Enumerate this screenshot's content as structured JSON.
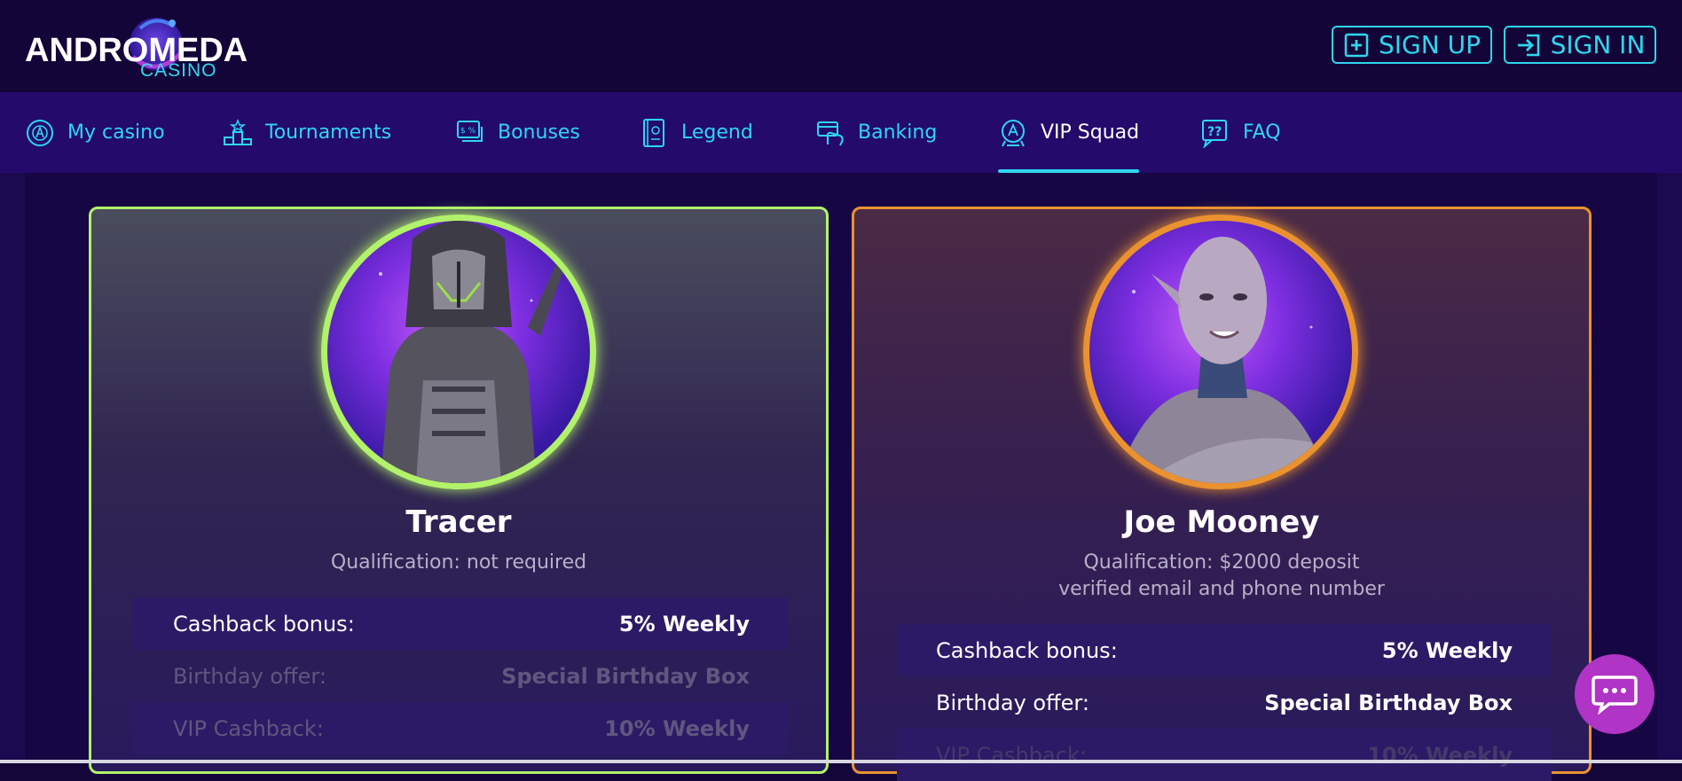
{
  "brand": {
    "name": "ANDROMEDA",
    "sub": "CASINO",
    "accent": "#2fd6ee"
  },
  "auth": {
    "signup": "SIGN UP",
    "signin": "SIGN IN"
  },
  "nav": {
    "items": [
      {
        "label": "My casino",
        "icon": "casino-chip-icon"
      },
      {
        "label": "Tournaments",
        "icon": "podium-icon"
      },
      {
        "label": "Bonuses",
        "icon": "bonus-cards-icon"
      },
      {
        "label": "Legend",
        "icon": "book-icon"
      },
      {
        "label": "Banking",
        "icon": "bank-card-icon"
      },
      {
        "label": "VIP Squad",
        "icon": "vip-badge-icon",
        "active": true
      },
      {
        "label": "FAQ",
        "icon": "question-icon"
      }
    ]
  },
  "cards": [
    {
      "name": "Tracer",
      "qualification": [
        "Qualification: not required"
      ],
      "border_color": "#b2f26a",
      "rows": [
        {
          "label": "Cashback bonus:",
          "value": "5% Weekly"
        },
        {
          "label": "Birthday offer:",
          "value": "Special Birthday Box"
        },
        {
          "label": "VIP Cashback:",
          "value": "10% Weekly"
        }
      ]
    },
    {
      "name": "Joe Mooney",
      "qualification": [
        "Qualification: $2000 deposit",
        "verified email and phone number"
      ],
      "border_color": "#ea9230",
      "rows": [
        {
          "label": "Cashback bonus:",
          "value": "5% Weekly"
        },
        {
          "label": "Birthday offer:",
          "value": "Special Birthday Box"
        },
        {
          "label": "VIP Cashback:",
          "value": "10% Weekly"
        }
      ]
    }
  ]
}
